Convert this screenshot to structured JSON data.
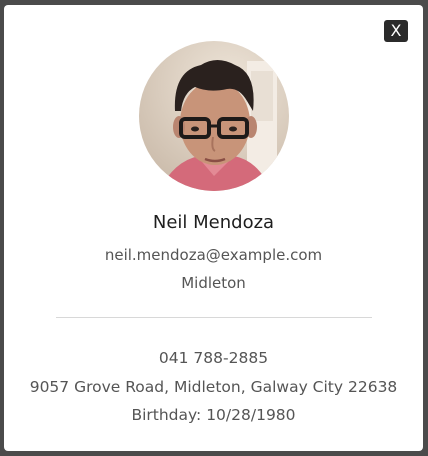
{
  "modal": {
    "close_label": "X"
  },
  "profile": {
    "name": "Neil Mendoza",
    "email": "neil.mendoza@example.com",
    "city": "Midleton",
    "phone": "041 788-2885",
    "address": "9057 Grove Road, Midleton, Galway City 22638",
    "birthday": "Birthday: 10/28/1980"
  },
  "colors": {
    "close_button_bg": "#2b2b2b",
    "modal_bg": "#ffffff",
    "backdrop": "#4b4b4b"
  },
  "icons": {
    "avatar": "user-photo"
  }
}
